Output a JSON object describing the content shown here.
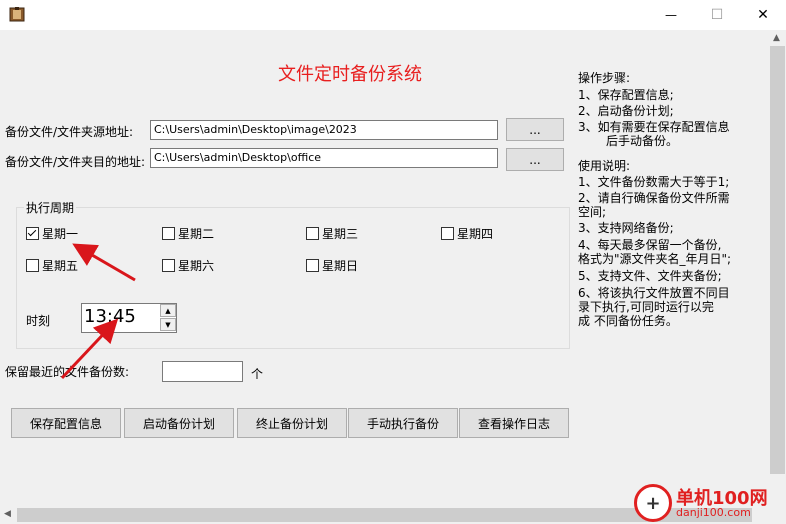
{
  "window": {
    "minimize_glyph": "—",
    "maximize_glyph": "☐",
    "close_glyph": "✕"
  },
  "main": {
    "title": "文件定时备份系统",
    "source_label": "备份文件/文件夹源地址:",
    "source_value": "C:\\Users\\admin\\Desktop\\image\\2023",
    "dest_label": "备份文件/文件夹目的地址:",
    "dest_value": "C:\\Users\\admin\\Desktop\\office",
    "browse_label": "..."
  },
  "schedule": {
    "group_title": "执行周期",
    "days": [
      {
        "label": "星期一",
        "checked": true
      },
      {
        "label": "星期二",
        "checked": false
      },
      {
        "label": "星期三",
        "checked": false
      },
      {
        "label": "星期四",
        "checked": false
      },
      {
        "label": "星期五",
        "checked": false
      },
      {
        "label": "星期六",
        "checked": false
      },
      {
        "label": "星期日",
        "checked": false
      }
    ],
    "time_label": "时刻",
    "time_value": "13:45"
  },
  "retain": {
    "label": "保留最近的文件备份数:",
    "value": "",
    "unit": "个"
  },
  "buttons": {
    "save": "保存配置信息",
    "start": "启动备份计划",
    "stop": "终止备份计划",
    "manual": "手动执行备份",
    "log": "查看操作日志"
  },
  "steps": {
    "title": "操作步骤:",
    "line1": "1、保存配置信息;",
    "line2": "2、启动备份计划;",
    "line3a": "3、如有需要在保存配置信息",
    "line3b": "后手动备份。"
  },
  "usage": {
    "title": "使用说明:",
    "line1": "1、文件备份数需大于等于1;",
    "line2a": "2、请自行确保备份文件所需",
    "line2b": "空间;",
    "line3": "3、支持网络备份;",
    "line4a": "4、每天最多保留一个备份,",
    "line4b": "格式为\"源文件夹名_年月日\";",
    "line5": "5、支持文件、文件夹备份;",
    "line6a": "6、将该执行文件放置不同目",
    "line6b": "录下执行,可同时运行以完",
    "line6c": "成 不同备份任务。"
  },
  "watermark": {
    "brand": "单机100网",
    "url": "danji100.com"
  },
  "colors": {
    "title_red": "#e81f1f",
    "arrow_red": "#d9161b",
    "watermark_red": "#e02020"
  }
}
